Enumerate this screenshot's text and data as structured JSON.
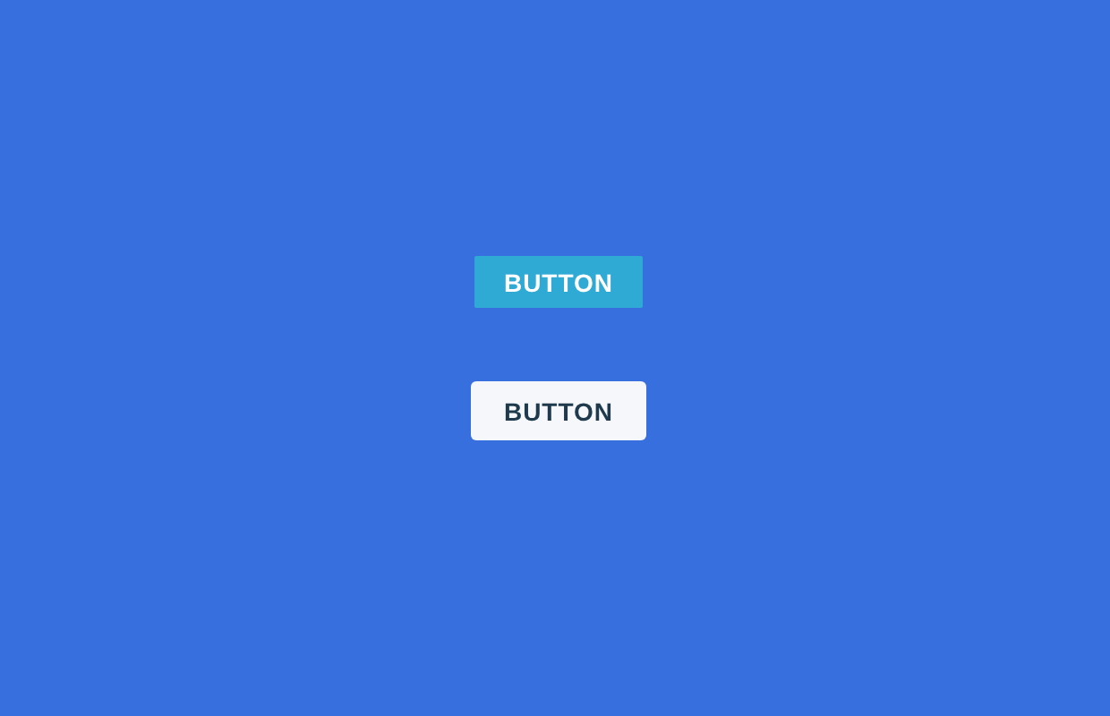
{
  "buttons": [
    {
      "label": "BUTTON",
      "kind": "filled"
    },
    {
      "label": "BUTTON",
      "kind": "light"
    }
  ]
}
